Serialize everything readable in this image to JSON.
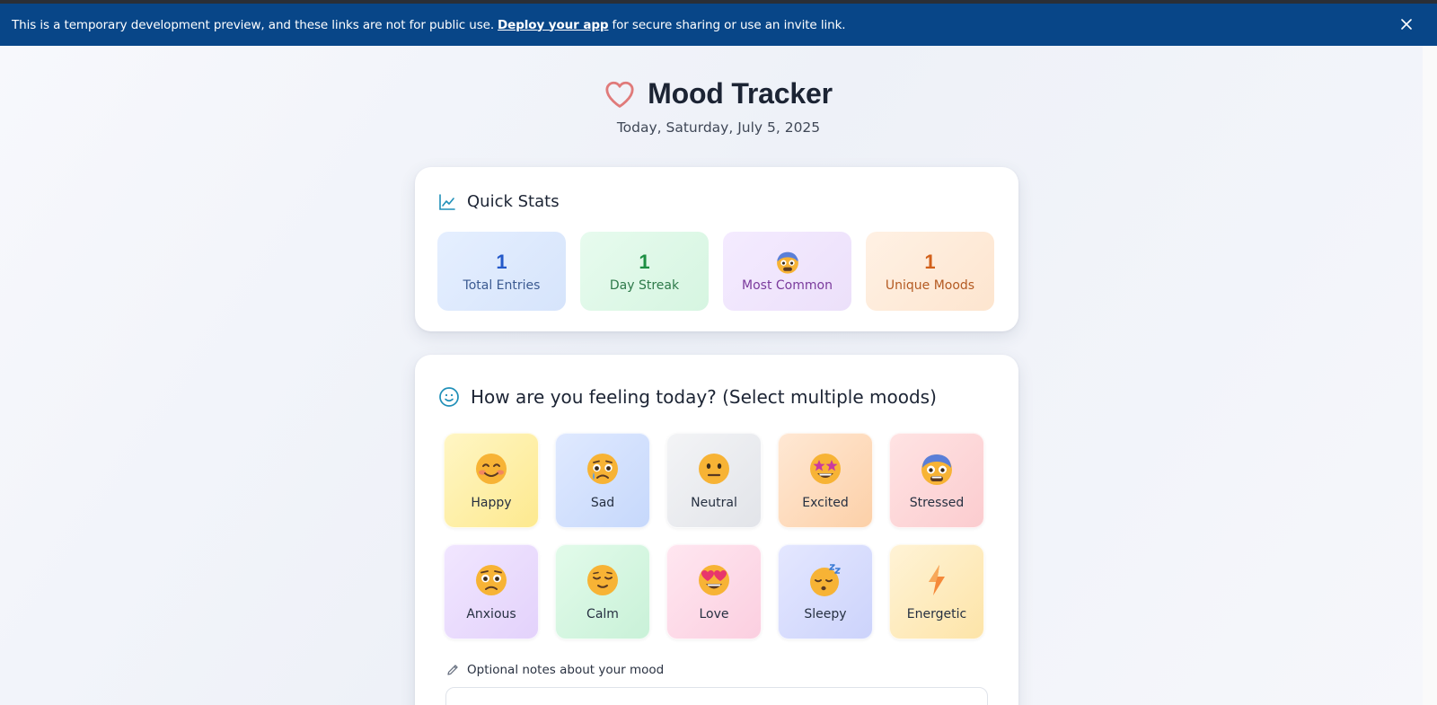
{
  "banner": {
    "text_before": "This is a temporary development preview, and these links are not for public use.",
    "link": "Deploy your app",
    "text_after": "for secure sharing or use an invite link."
  },
  "header": {
    "title": "Mood Tracker",
    "subtitle": "Today, Saturday, July 5, 2025"
  },
  "stats": {
    "heading": "Quick Stats",
    "items": [
      {
        "value": "1",
        "label": "Total Entries"
      },
      {
        "value": "1",
        "label": "Day Streak"
      },
      {
        "value": "",
        "label": "Most Common",
        "icon": "stressed-emoji"
      },
      {
        "value": "1",
        "label": "Unique Moods"
      }
    ]
  },
  "moods": {
    "heading": "How are you feeling today? (Select multiple moods)",
    "options": [
      {
        "label": "Happy",
        "icon": "smiling-face-with-smiling-eyes"
      },
      {
        "label": "Sad",
        "icon": "crying-face"
      },
      {
        "label": "Neutral",
        "icon": "neutral-face"
      },
      {
        "label": "Excited",
        "icon": "star-struck-face"
      },
      {
        "label": "Stressed",
        "icon": "anxious-face-with-sweat"
      },
      {
        "label": "Anxious",
        "icon": "worried-face"
      },
      {
        "label": "Calm",
        "icon": "relieved-face"
      },
      {
        "label": "Love",
        "icon": "heart-eyes-face"
      },
      {
        "label": "Sleepy",
        "icon": "sleeping-face"
      },
      {
        "label": "Energetic",
        "icon": "lightning-bolt"
      }
    ]
  },
  "notes": {
    "label": "Optional notes about your mood"
  },
  "colors": {
    "banner_bg": "#084688",
    "heart": "#e07a7a",
    "accent_teal": "#1f8fb8"
  }
}
